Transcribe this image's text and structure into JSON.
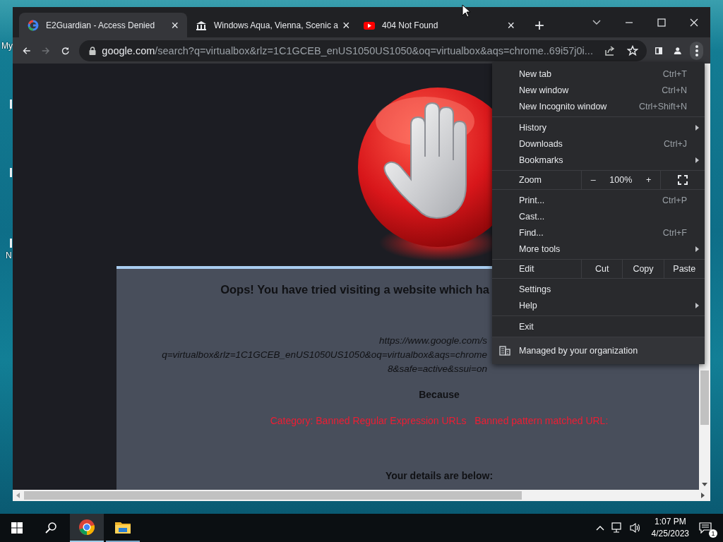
{
  "desktop": {
    "icon_labels": [
      "My",
      "N"
    ]
  },
  "browser": {
    "tabs": [
      {
        "title": "E2Guardian - Access Denied",
        "kind": "google",
        "selected": true,
        "close": "×"
      },
      {
        "title": "Windows Aqua, Vienna, Scenic a",
        "kind": "museum",
        "selected": false,
        "close": "×"
      },
      {
        "title": "404 Not Found",
        "kind": "youtube",
        "selected": false,
        "close": "×"
      }
    ],
    "new_tab": "+",
    "toolbar": {
      "forward": {
        "disabled": true
      },
      "menu_button": {
        "pressed": true
      }
    },
    "address": {
      "host": "google.com",
      "path": "/search?q=virtualbox&rlz=1C1GCEB_enUS1050US1050&oq=virtualbox&aqs=chrome..69i57j0i..."
    }
  },
  "page": {
    "heading": "Oops! You have tried visiting a website which ha",
    "url_lines": [
      "https://www.google.com/s",
      "q=virtualbox&rlz=1C1GCEB_enUS1050US1050&oq=virtualbox&aqs=chrome",
      "8&safe=active&ssui=on"
    ],
    "because": "Because",
    "reason": "Category: Banned Regular Expression URLs   Banned pattern matched URL:",
    "details_heading": "Your details are below:"
  },
  "menu": {
    "sections": [
      {
        "items": [
          {
            "kind": "item",
            "label": "New tab",
            "shortcut": "Ctrl+T",
            "submenu": false
          },
          {
            "kind": "item",
            "label": "New window",
            "shortcut": "Ctrl+N",
            "submenu": false
          },
          {
            "kind": "item",
            "label": "New Incognito window",
            "shortcut": "Ctrl+Shift+N",
            "submenu": false
          }
        ]
      },
      {
        "items": [
          {
            "kind": "item",
            "label": "History",
            "submenu": true
          },
          {
            "kind": "item",
            "label": "Downloads",
            "shortcut": "Ctrl+J",
            "submenu": false
          },
          {
            "kind": "item",
            "label": "Bookmarks",
            "submenu": true
          }
        ]
      },
      {
        "items": [
          {
            "kind": "zoom",
            "label": "Zoom",
            "minus": "–",
            "value": "100%",
            "plus": "+"
          }
        ]
      },
      {
        "items": [
          {
            "kind": "item",
            "label": "Print...",
            "shortcut": "Ctrl+P",
            "submenu": false
          },
          {
            "kind": "item",
            "label": "Cast...",
            "submenu": false
          },
          {
            "kind": "item",
            "label": "Find...",
            "shortcut": "Ctrl+F",
            "submenu": false
          },
          {
            "kind": "item",
            "label": "More tools",
            "submenu": true
          }
        ]
      },
      {
        "items": [
          {
            "kind": "edit",
            "label": "Edit",
            "actions": [
              "Cut",
              "Copy",
              "Paste"
            ]
          }
        ]
      },
      {
        "items": [
          {
            "kind": "item",
            "label": "Settings",
            "submenu": false
          },
          {
            "kind": "item",
            "label": "Help",
            "submenu": true
          }
        ]
      },
      {
        "items": [
          {
            "kind": "item",
            "label": "Exit",
            "submenu": false
          }
        ]
      },
      {
        "items": [
          {
            "kind": "managed",
            "label": "Managed by your organization"
          }
        ]
      }
    ]
  },
  "taskbar": {
    "apps": [
      {
        "kind": "chrome",
        "active": true
      },
      {
        "kind": "explorer",
        "active": false
      }
    ],
    "time": "1:07 PM",
    "date": "4/25/2023",
    "notifications": "1"
  }
}
